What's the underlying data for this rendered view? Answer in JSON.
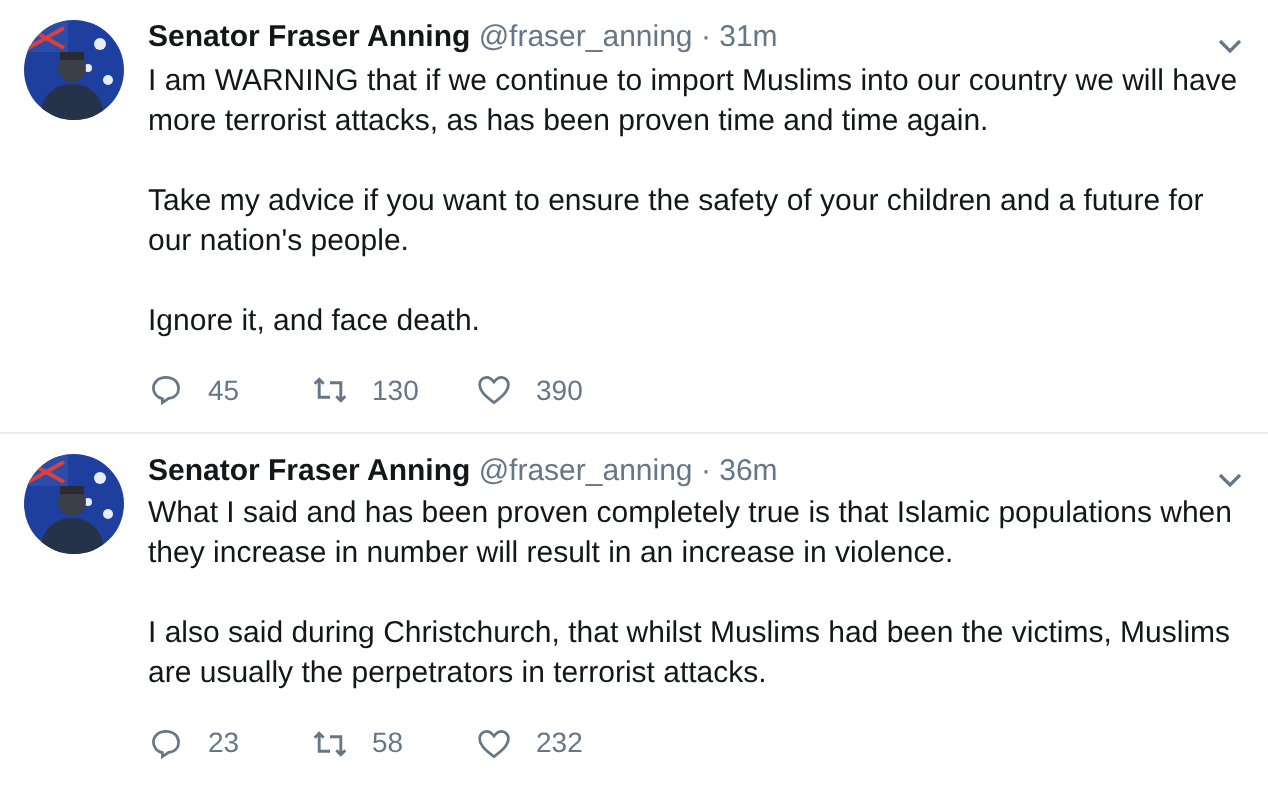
{
  "tweets": [
    {
      "name": "Senator Fraser Anning",
      "handle": "@fraser_anning",
      "time": "· 31m",
      "paragraphs": [
        "I am WARNING that if we continue to import Muslims into our country we will have more terrorist attacks, as has been proven time and time again.",
        "Take my advice if you want to ensure the safety of your children and a future for our nation's people.",
        "Ignore it, and face death."
      ],
      "replies": "45",
      "retweets": "130",
      "likes": "390"
    },
    {
      "name": "Senator Fraser Anning",
      "handle": "@fraser_anning",
      "time": "· 36m",
      "paragraphs": [
        "What I said and has been proven completely true is that Islamic populations when they increase in number will result in an increase in violence.",
        "I also said during Christchurch, that whilst Muslims had been the victims, Muslims are usually the perpetrators in terrorist attacks."
      ],
      "replies": "23",
      "retweets": "58",
      "likes": "232"
    }
  ]
}
